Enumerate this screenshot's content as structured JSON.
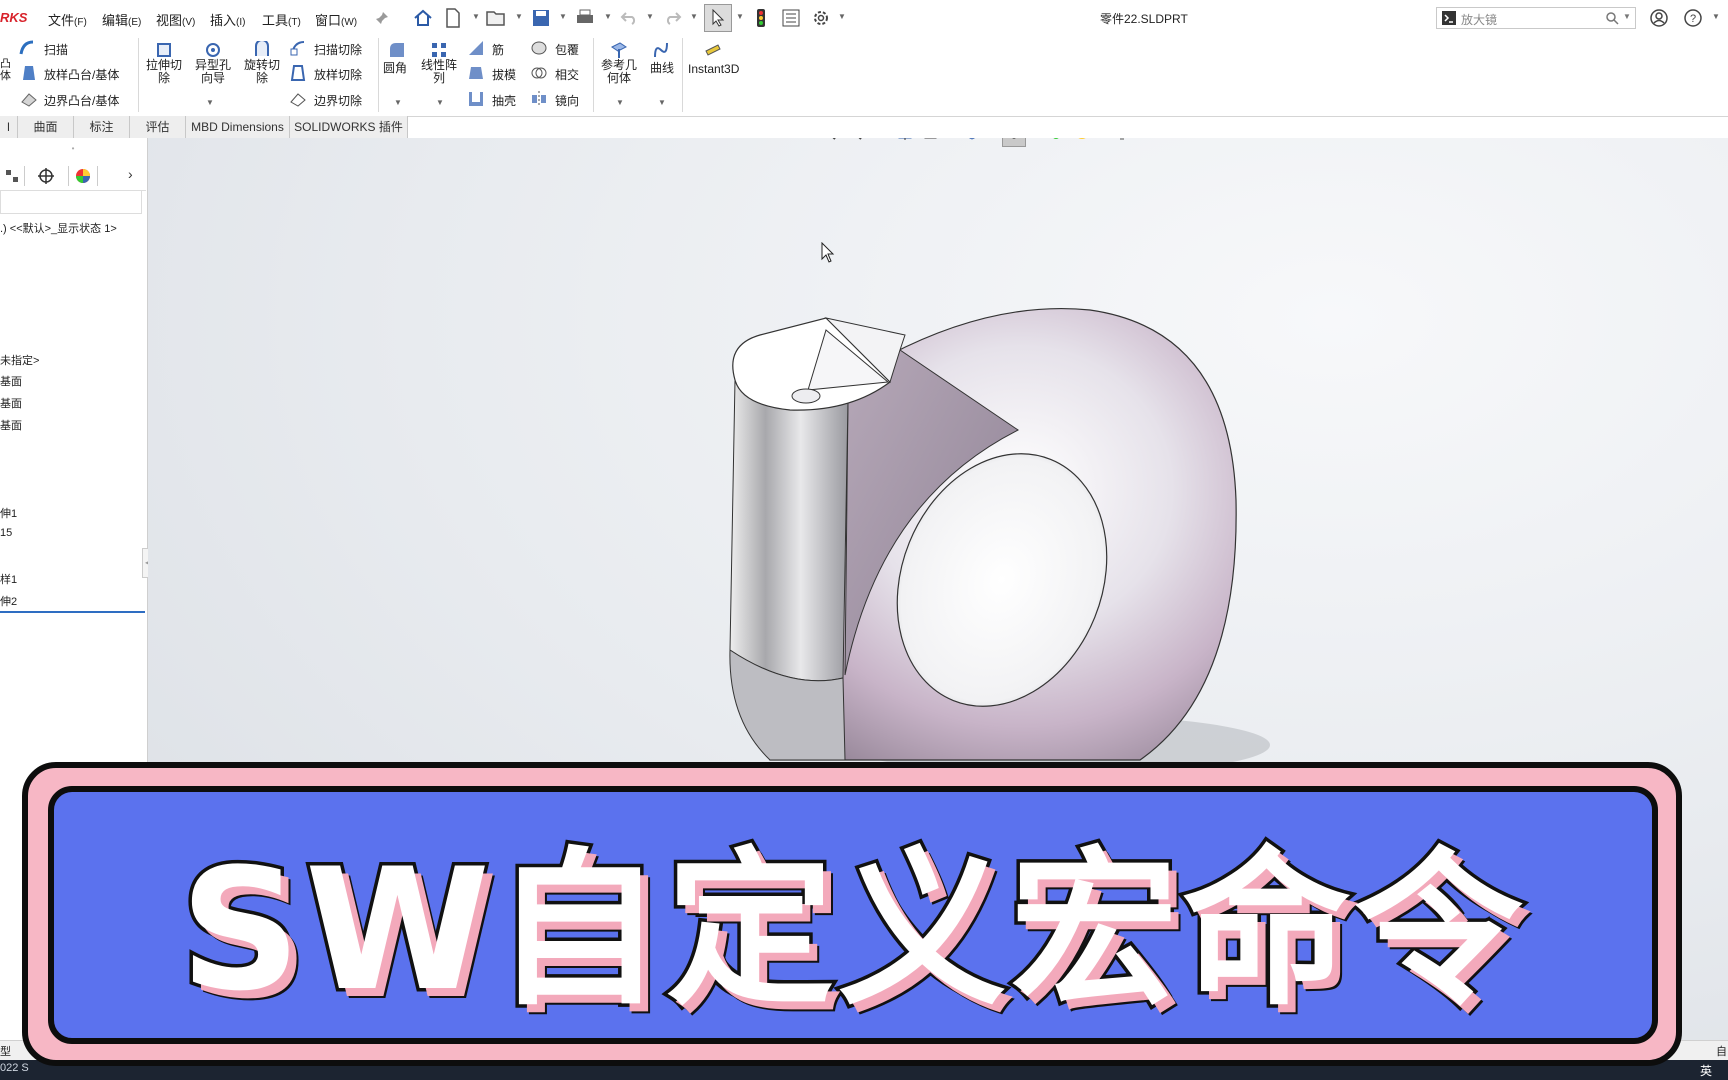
{
  "app": {
    "logo": "RKS",
    "document_title": "零件22.SLDPRT"
  },
  "menu": [
    {
      "label": "文件",
      "key": "(F)"
    },
    {
      "label": "编辑",
      "key": "(E)"
    },
    {
      "label": "视图",
      "key": "(V)"
    },
    {
      "label": "插入",
      "key": "(I)"
    },
    {
      "label": "工具",
      "key": "(T)"
    },
    {
      "label": "窗口",
      "key": "(W)"
    }
  ],
  "search": {
    "placeholder": "放大镜"
  },
  "command_manager": {
    "col1": {
      "top_partial": "凸\n体",
      "sweep": "扫描",
      "loft": "放样凸台/基体",
      "boundary": "边界凸台/基体"
    },
    "col2": {
      "extrude_cut": "拉伸切\n除",
      "hole_wizard": "异型孔\n向导",
      "revolve_cut": "旋转切\n除"
    },
    "col3": {
      "sweep_cut": "扫描切除",
      "loft_cut": "放样切除",
      "boundary_cut": "边界切除"
    },
    "col4": {
      "fillet": "圆角",
      "linear_pattern": "线性阵\n列",
      "rib": "筋",
      "draft": "拔模",
      "shell": "抽壳",
      "wrap": "包覆",
      "intersect": "相交",
      "mirror": "镜向"
    },
    "col5": {
      "ref_geometry": "参考几\n何体",
      "curves": "曲线",
      "instant3d": "Instant3D"
    }
  },
  "tabs": [
    "l",
    "曲面",
    "标注",
    "评估",
    "MBD Dimensions",
    "SOLIDWORKS 插件"
  ],
  "feature_tree": {
    "config_line": ".) <<默认>_显示状态 1>",
    "items": [
      "未指定>",
      "基面",
      "基面",
      "基面",
      "伸1",
      "15",
      "样1",
      "伸2"
    ]
  },
  "status": {
    "left_tab": "型",
    "version": "022 S",
    "right": "自"
  },
  "banner": {
    "text": "SW自定义宏命令"
  },
  "taskbar": {
    "ime": "英"
  },
  "colors": {
    "banner_blue": "#5b72ee",
    "banner_pink": "#f7b7c5",
    "logo_red": "#d8222a"
  }
}
